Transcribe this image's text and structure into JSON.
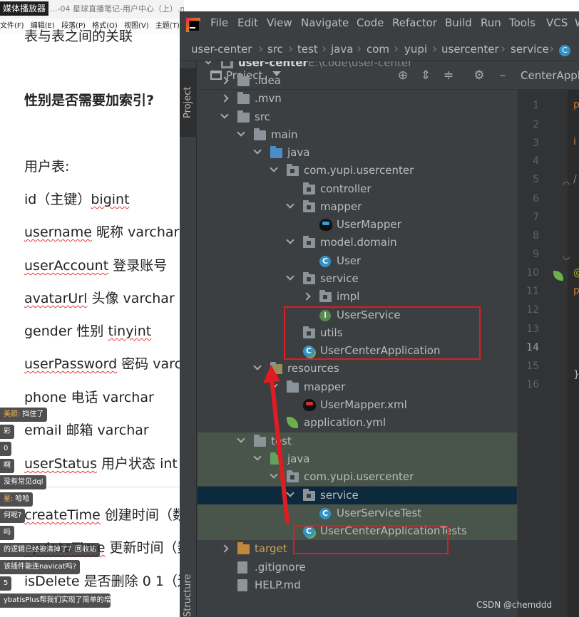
{
  "doc": {
    "player_badge": "媒体播放器",
    "title": "...-04 星球直播笔记-用户中心（上）.md - Ty",
    "menu": [
      "文件(F)",
      "编辑(E)",
      "段落(P)",
      "格式(O)",
      "视图(V)",
      "主题(T)"
    ],
    "heading_partial": "表与表之间的关联",
    "question": "性别是否需要加索引?",
    "user_table": "用户表:",
    "fields": [
      {
        "name": "id",
        "desc": "（主键）",
        "type": "bigint"
      },
      {
        "name": "username",
        "desc": " 昵称  ",
        "type": "varchar"
      },
      {
        "name": "userAccount",
        "desc": " 登录账号",
        "type": ""
      },
      {
        "name": "avatarUrl",
        "desc": " 头像 ",
        "type": "varchar"
      },
      {
        "name": "gender",
        "desc": " 性别 ",
        "type": "tinyint"
      },
      {
        "name": "userPassword",
        "desc": " 密码  ",
        "type": "varc"
      },
      {
        "name": "phone",
        "desc": " 电话 ",
        "type": "varchar"
      },
      {
        "name": "email",
        "desc": " 邮箱 ",
        "type": "varchar"
      },
      {
        "name": "userStatus",
        "desc": " 用户状态 ",
        "type": "int"
      },
      {
        "name": "createTime",
        "desc": " 创建时间（数",
        "type": ""
      },
      {
        "name": "updateTime",
        "desc": " 更新时间（数",
        "type": ""
      },
      {
        "name": "isDelete",
        "desc": " 是否删除 0 1（逻",
        "type": ""
      }
    ]
  },
  "danmaku": [
    {
      "nick": "美颜:",
      "text": "挡住了"
    },
    {
      "nick": "",
      "text": "彩"
    },
    {
      "nick": "",
      "text": "0"
    },
    {
      "nick": "",
      "text": "啊"
    },
    {
      "nick": "",
      "text": "没有常见dql"
    },
    {
      "nick": "星:",
      "text": "哈哈"
    },
    {
      "nick": "",
      "text": "何呢?"
    },
    {
      "nick": "",
      "text": "吗"
    },
    {
      "nick": "",
      "text": "的逻辑已经被清掉了？回收站"
    },
    {
      "nick": "",
      "text": "该插件能连navicat吗?"
    },
    {
      "nick": "",
      "text": "5"
    },
    {
      "nick": "",
      "text": "ybatisPlus帮我们实现了简单的增"
    }
  ],
  "ide": {
    "menu": [
      "File",
      "Edit",
      "View",
      "Navigate",
      "Code",
      "Refactor",
      "Build",
      "Run",
      "Tools",
      "VCS",
      "W"
    ],
    "breadcrumb": [
      "user-center",
      "src",
      "test",
      "java",
      "com",
      "yupi",
      "usercenter",
      "service"
    ],
    "breadcrumb_file_icon": "C",
    "project_label": "Project",
    "structure_label": "Structure",
    "editor_tab": "CenterAppl",
    "tree": [
      {
        "label": "user-center",
        "extra": "E:\\code\\user-center",
        "icon": "module-folder-icon",
        "arrow": "down",
        "bold": true
      },
      {
        "label": ".idea",
        "icon": "folder-icon",
        "arrow": "right"
      },
      {
        "label": ".mvn",
        "icon": "folder-icon",
        "arrow": "right"
      },
      {
        "label": "src",
        "icon": "folder-icon",
        "arrow": "down"
      },
      {
        "label": "main",
        "icon": "folder-icon",
        "arrow": "down"
      },
      {
        "label": "java",
        "icon": "source-folder-icon",
        "arrow": "down"
      },
      {
        "label": "com.yupi.usercenter",
        "icon": "package-icon",
        "arrow": "down"
      },
      {
        "label": "controller",
        "icon": "package-icon",
        "arrow": ""
      },
      {
        "label": "mapper",
        "icon": "package-icon",
        "arrow": "down"
      },
      {
        "label": "UserMapper",
        "icon": "mybatis-mapper-icon",
        "arrow": ""
      },
      {
        "label": "model.domain",
        "icon": "package-icon",
        "arrow": "down"
      },
      {
        "label": "User",
        "icon": "class-icon",
        "arrow": ""
      },
      {
        "label": "service",
        "icon": "package-icon",
        "arrow": "down"
      },
      {
        "label": "impl",
        "icon": "package-icon",
        "arrow": "right"
      },
      {
        "label": "UserService",
        "icon": "interface-icon",
        "arrow": ""
      },
      {
        "label": "utils",
        "icon": "package-icon",
        "arrow": ""
      },
      {
        "label": "UserCenterApplication",
        "icon": "spring-class-icon",
        "arrow": ""
      },
      {
        "label": "resources",
        "icon": "resources-folder-icon",
        "arrow": "down"
      },
      {
        "label": "mapper",
        "icon": "folder-icon",
        "arrow": "down"
      },
      {
        "label": "UserMapper.xml",
        "icon": "mybatis-xml-icon",
        "arrow": ""
      },
      {
        "label": "application.yml",
        "icon": "spring-yml-icon",
        "arrow": ""
      },
      {
        "label": "test",
        "icon": "folder-icon",
        "arrow": "down"
      },
      {
        "label": "java",
        "icon": "test-source-folder-icon",
        "arrow": "down"
      },
      {
        "label": "com.yupi.usercenter",
        "icon": "package-icon",
        "arrow": "down"
      },
      {
        "label": "service",
        "icon": "package-icon",
        "arrow": "down"
      },
      {
        "label": "UserServiceTest",
        "icon": "class-icon",
        "arrow": ""
      },
      {
        "label": "UserCenterApplicationTests",
        "icon": "spring-class-icon",
        "arrow": ""
      },
      {
        "label": "target",
        "icon": "excluded-folder-icon",
        "arrow": "right"
      },
      {
        "label": ".gitignore",
        "icon": "file-icon",
        "arrow": ""
      },
      {
        "label": "HELP.md",
        "icon": "file-icon",
        "arrow": ""
      }
    ],
    "line_numbers": [
      "1",
      "2",
      "3",
      "4",
      "5",
      "6",
      "7",
      "8",
      "9",
      "10",
      "11",
      "12",
      "13",
      "14",
      "15",
      "16"
    ],
    "current_line": "14",
    "code_fragments": [
      "p",
      "i",
      "/",
      "@",
      "p",
      "}"
    ]
  },
  "watermark": "CSDN @chemddd",
  "colors": {
    "annotation": "#e11b22",
    "selection": "#0d293e"
  }
}
